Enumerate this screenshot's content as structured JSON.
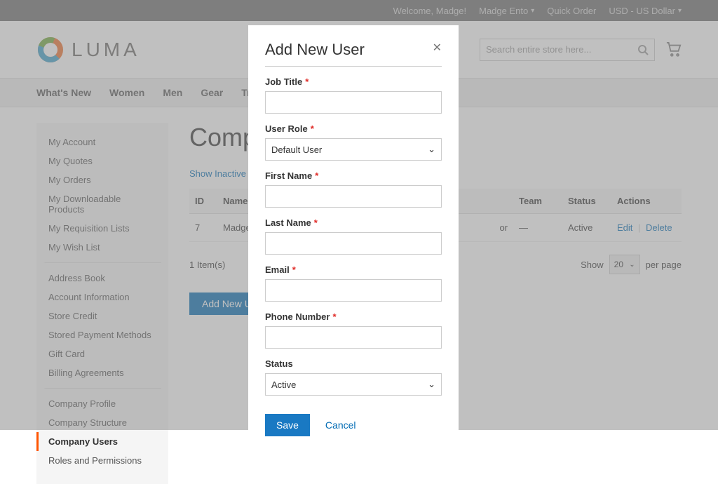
{
  "topbar": {
    "welcome": "Welcome, Madge!",
    "userMenu": "Madge Ento",
    "quickOrder": "Quick Order",
    "currency": "USD - US Dollar"
  },
  "header": {
    "brand": "LUMA",
    "searchPlaceholder": "Search entire store here..."
  },
  "nav": {
    "items": [
      "What's New",
      "Women",
      "Men",
      "Gear",
      "Training"
    ]
  },
  "sidebar": {
    "items": [
      "My Account",
      "My Quotes",
      "My Orders",
      "My Downloadable Products",
      "My Requisition Lists",
      "My Wish List"
    ],
    "items2": [
      "Address Book",
      "Account Information",
      "Store Credit",
      "Stored Payment Methods",
      "Gift Card",
      "Billing Agreements"
    ],
    "items3": [
      "Company Profile",
      "Company Structure",
      "Company Users",
      "Roles and Permissions"
    ],
    "activeIndex": 2
  },
  "main": {
    "title": "Compa",
    "showInactive": "Show Inactive Users",
    "columns": {
      "id": "ID",
      "name": "Name",
      "team": "Team",
      "status": "Status",
      "actions": "Actions"
    },
    "row": {
      "id": "7",
      "name": "Madge Ent",
      "roleEnd": "or",
      "team": "—",
      "status": "Active",
      "edit": "Edit",
      "delete": "Delete"
    },
    "itemsCount": "1 Item(s)",
    "showLabel": "Show",
    "perPage": "per page",
    "pageSize": "20",
    "addNewUser": "Add New User"
  },
  "modal": {
    "title": "Add New User",
    "fields": {
      "jobTitle": "Job Title",
      "userRole": "User Role",
      "userRoleValue": "Default User",
      "firstName": "First Name",
      "lastName": "Last Name",
      "email": "Email",
      "phone": "Phone Number",
      "status": "Status",
      "statusValue": "Active"
    },
    "save": "Save",
    "cancel": "Cancel"
  }
}
